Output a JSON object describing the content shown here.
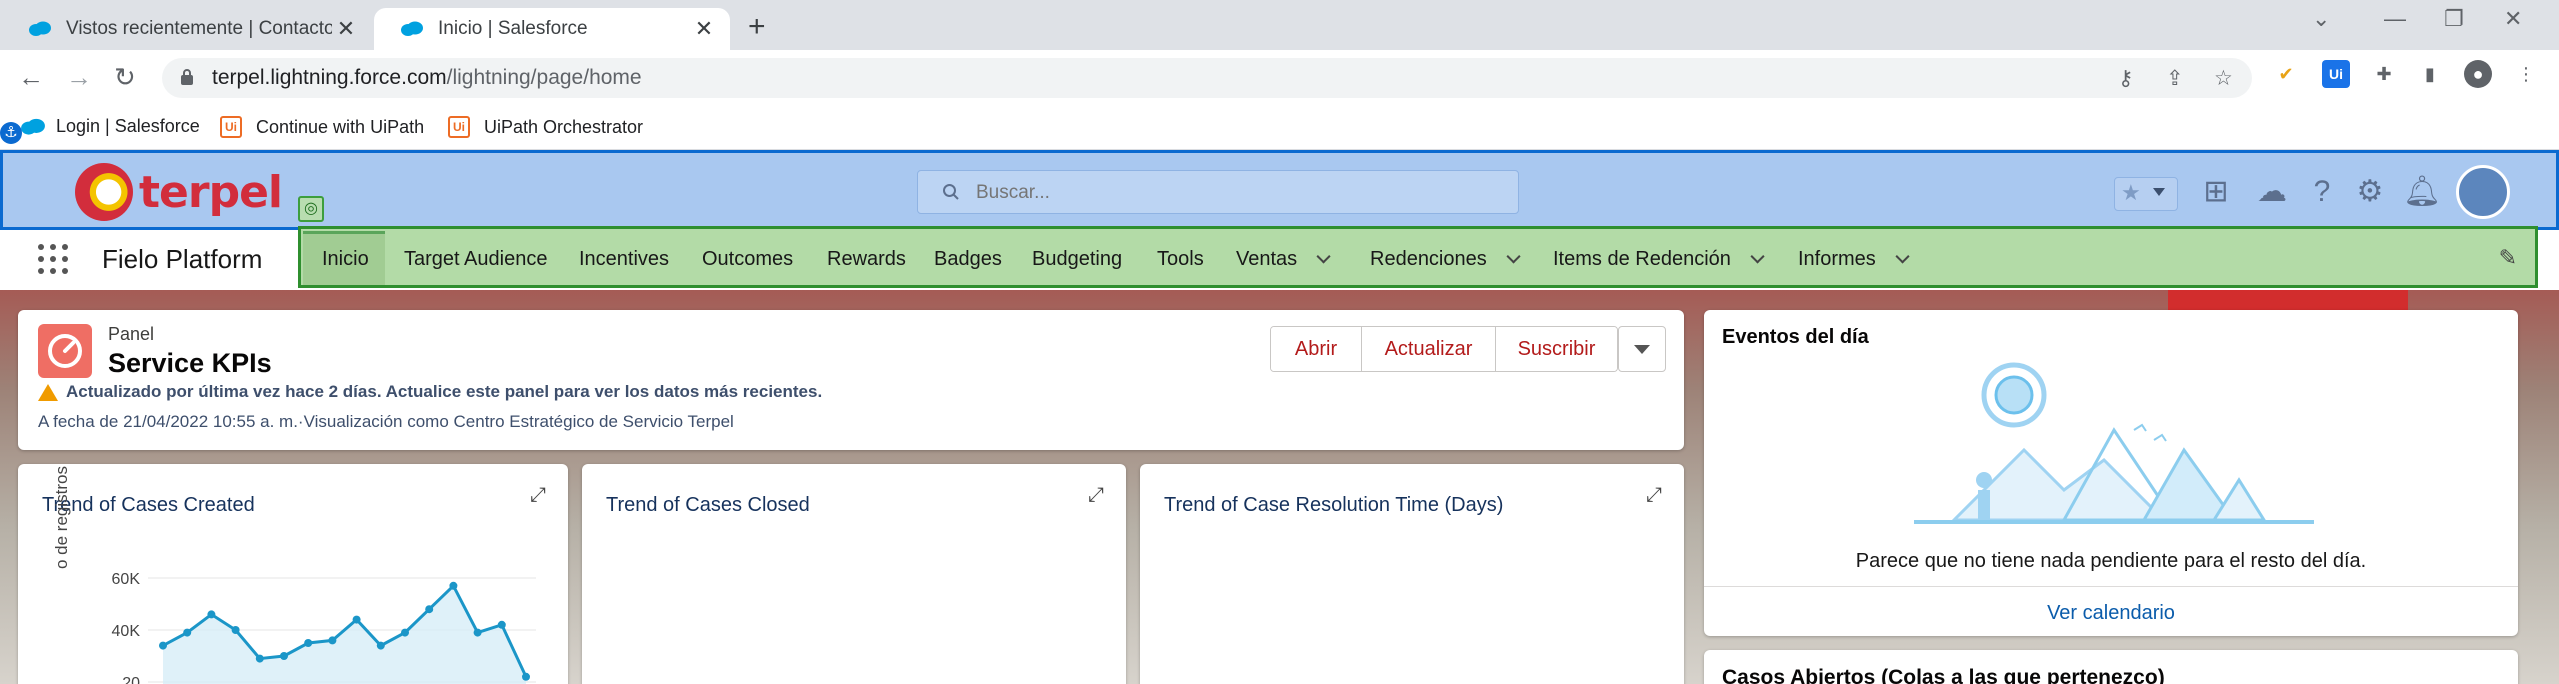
{
  "browser": {
    "tabs": [
      {
        "title": "Vistos recientemente | Contactos"
      },
      {
        "title": "Inicio | Salesforce"
      }
    ],
    "url_host": "terpel.lightning.force.com",
    "url_path": "/lightning/page/home",
    "bookmarks": [
      {
        "label": "Login | Salesforce"
      },
      {
        "label": "Continue with UiPath"
      },
      {
        "label": "UiPath Orchestrator"
      }
    ]
  },
  "header": {
    "logo_text": "terpel",
    "search_placeholder": "Buscar..."
  },
  "app": {
    "name": "Fielo Platform",
    "nav": [
      {
        "label": "Inicio"
      },
      {
        "label": "Target Audience"
      },
      {
        "label": "Incentives"
      },
      {
        "label": "Outcomes"
      },
      {
        "label": "Rewards"
      },
      {
        "label": "Badges"
      },
      {
        "label": "Budgeting"
      },
      {
        "label": "Tools"
      },
      {
        "label": "Ventas"
      },
      {
        "label": "Redenciones"
      },
      {
        "label": "Items de Redención"
      },
      {
        "label": "Informes"
      }
    ]
  },
  "panel": {
    "kind": "Panel",
    "title": "Service KPIs",
    "warning": "Actualizado por última vez hace 2 días. Actualice este panel para ver los datos más recientes.",
    "as_of": "A fecha de 21/04/2022 10:55 a. m.·Visualización como Centro Estratégico de Servicio Terpel",
    "buttons": {
      "open": "Abrir",
      "refresh": "Actualizar",
      "subscribe": "Suscribir"
    }
  },
  "widgets": [
    {
      "title": "Trend of Cases Created",
      "ylabel": "o de registros"
    },
    {
      "title": "Trend of Cases Closed"
    },
    {
      "title": "Trend of Case Resolution Time (Days)"
    }
  ],
  "chart_data": {
    "type": "area",
    "title": "Trend of Cases Created",
    "ylabel": "o de registros",
    "yticks": [
      "60K",
      "40K",
      "20"
    ],
    "ylim": [
      0,
      70000
    ],
    "values": [
      34000,
      39000,
      46000,
      40000,
      29000,
      30000,
      35000,
      36000,
      44000,
      34000,
      39000,
      48000,
      57000,
      39000,
      42000,
      22000
    ]
  },
  "events": {
    "title": "Eventos del día",
    "message": "Parece que no tiene nada pendiente para el resto del día.",
    "link": "Ver calendario"
  },
  "cases": {
    "title": "Casos Abiertos (Colas a las que pertenezco)"
  },
  "colors": {
    "header_overlay": "#a9c8f0",
    "nav_overlay": "#b3dba7",
    "accent_red": "#b31b1b",
    "chart_line": "#1b96c8"
  }
}
